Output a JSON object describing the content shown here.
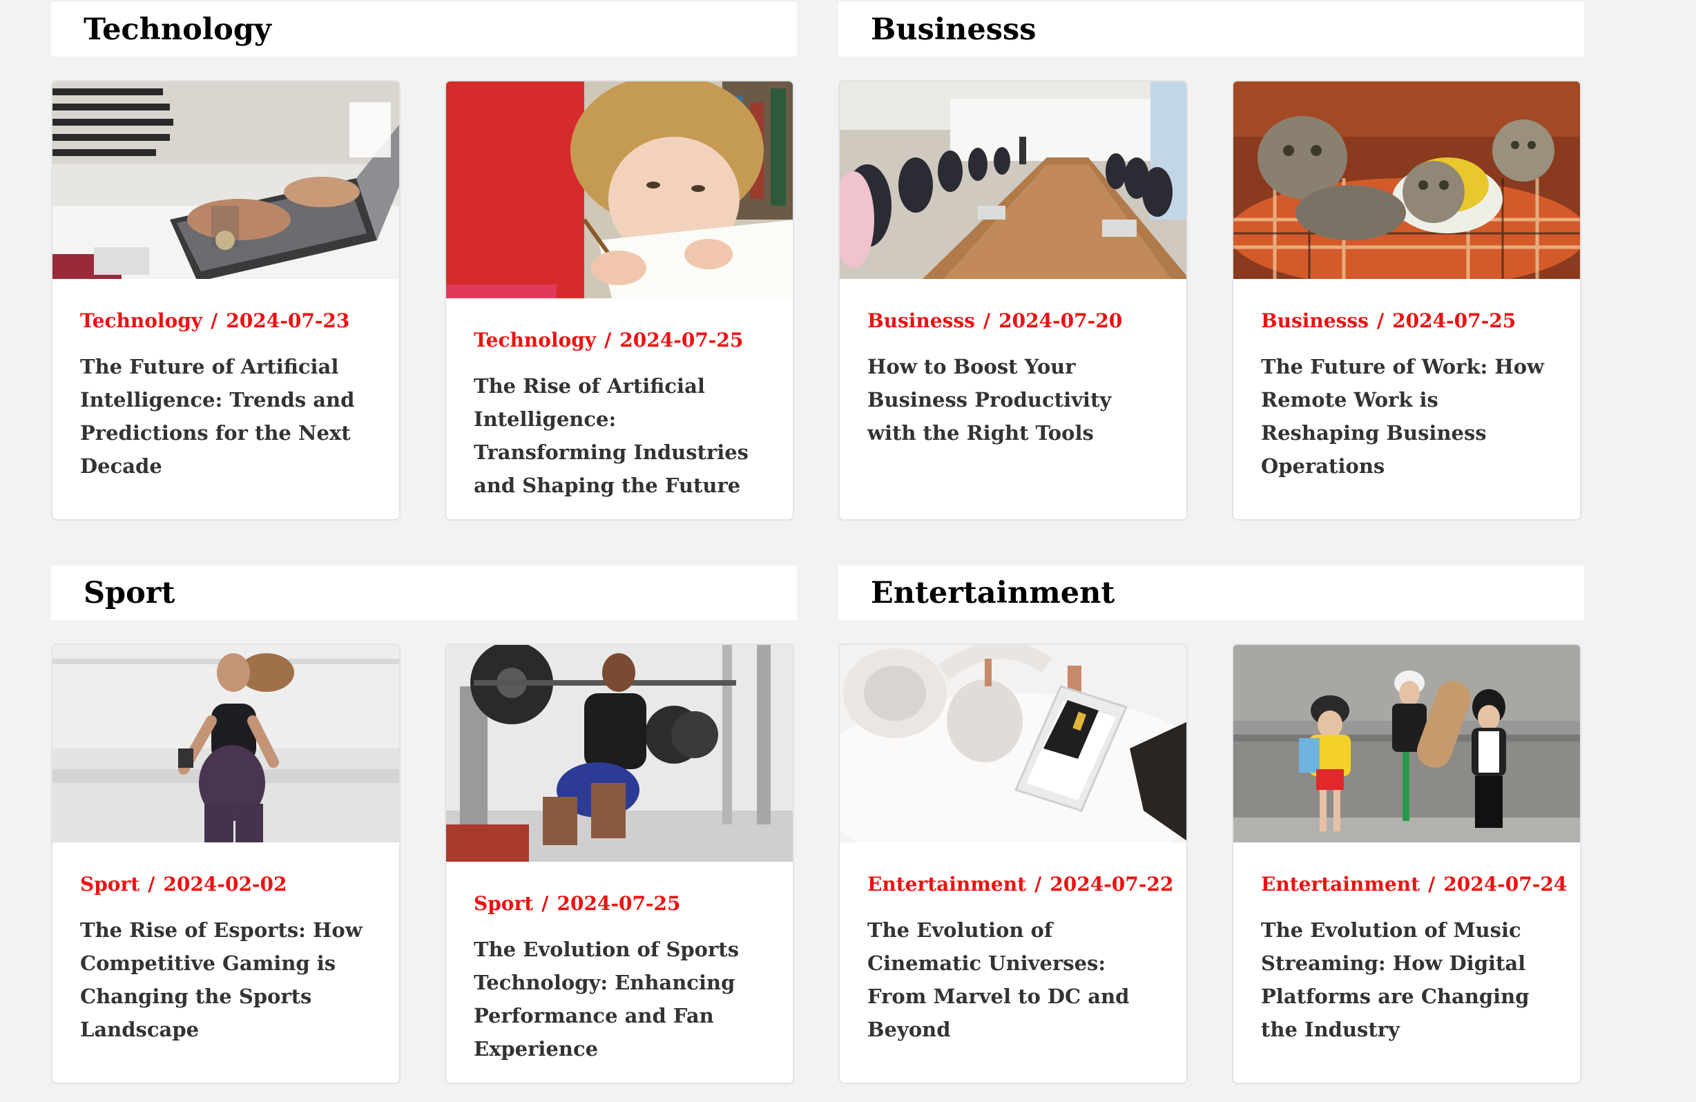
{
  "sections": [
    {
      "title": "Technology",
      "posts": [
        {
          "category": "Technology",
          "date": "2024-07-23",
          "title": "The Future of Artificial Intelligence: Trends and Predictions for the Next Decade",
          "image": "laptop-typing-photo"
        },
        {
          "category": "Technology",
          "date": "2024-07-25",
          "title": "The Rise of Artificial Intelligence: Transforming Industries and Shaping the Future",
          "image": "child-drawing-photo"
        }
      ]
    },
    {
      "title": "Businesss",
      "posts": [
        {
          "category": "Businesss",
          "date": "2024-07-20",
          "title": "How to Boost Your Business Productivity with the Right Tools",
          "image": "conference-meeting-photo"
        },
        {
          "category": "Businesss",
          "date": "2024-07-25",
          "title": "The Future of Work: How Remote Work is Reshaping Business Operations",
          "image": "kittens-photo"
        }
      ]
    },
    {
      "title": "Sport",
      "posts": [
        {
          "category": "Sport",
          "date": "2024-02-02",
          "title": "The Rise of Esports: How Competitive Gaming is Changing the Sports Landscape",
          "image": "woman-running-photo"
        },
        {
          "category": "Sport",
          "date": "2024-07-25",
          "title": "The Evolution of Sports Technology: Enhancing Performance and Fan Experience",
          "image": "gym-squat-photo"
        }
      ]
    },
    {
      "title": "Entertainment",
      "posts": [
        {
          "category": "Entertainment",
          "date": "2024-07-22",
          "title": "The Evolution of Cinematic Universes: From Marvel to DC and Beyond",
          "image": "headphones-phone-photo"
        },
        {
          "category": "Entertainment",
          "date": "2024-07-24",
          "title": "The Evolution of Music Streaming: How Digital Platforms are Changing the Industry",
          "image": "kids-fashion-photo"
        }
      ]
    }
  ],
  "colors": {
    "accent": "#ee1111",
    "title_text": "#333333",
    "page_bg": "#f2f2f2"
  }
}
